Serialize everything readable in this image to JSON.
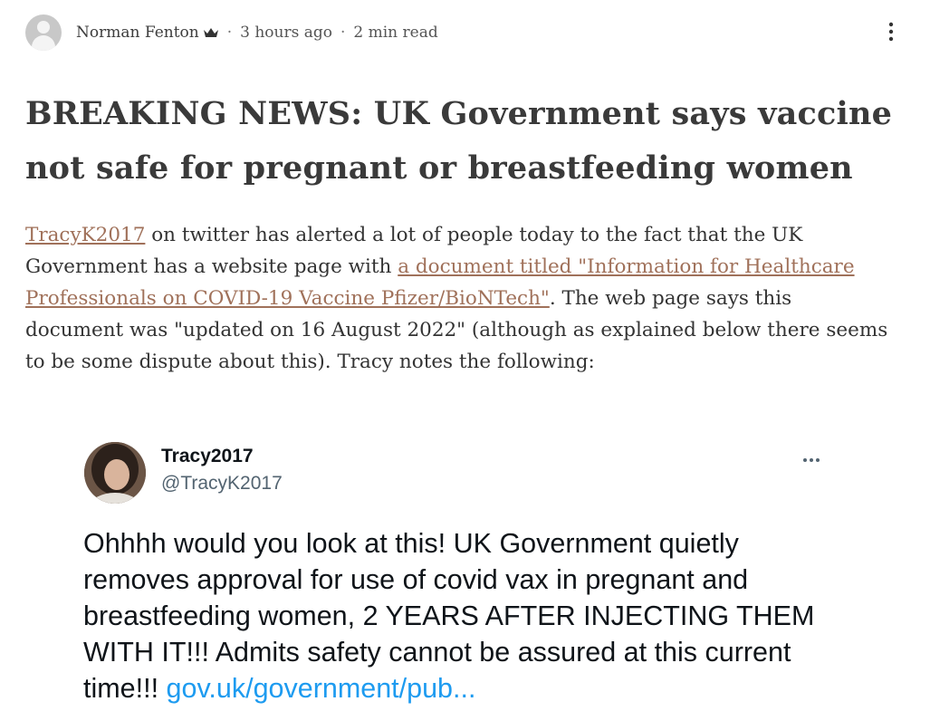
{
  "byline": {
    "author": "Norman Fenton",
    "crown_icon": "crown-icon",
    "separator": "·",
    "time": "3 hours ago",
    "read_time": "2 min read",
    "more_icon": "more-vertical-icon"
  },
  "article": {
    "title": "BREAKING NEWS: UK Government says vaccine not safe for pregnant or breastfeeding women",
    "para1": {
      "link1": "TracyK2017",
      "text1": " on twitter has alerted a lot of people today to the fact that the UK Government has a website page with ",
      "link2": "a document titled \"Information for Healthcare Professionals on COVID-19 Vaccine Pfizer/BioNTech\"",
      "text2": ". The web page says this document was \"updated on 16 August 2022\" (although as explained below there seems to be some dispute about this). Tracy notes the following:"
    }
  },
  "tweet": {
    "name": "Tracy2017",
    "handle": "@TracyK2017",
    "more_icon": "more-horizontal-icon",
    "text": "Ohhhh would you look at this! UK Government quietly removes approval for use of covid vax in pregnant and breastfeeding women, 2 YEARS AFTER INJECTING THEM WITH IT!!! Admits safety cannot be assured at this current time!!! ",
    "link": "gov.uk/government/pub..."
  },
  "colors": {
    "link": "#a0715a",
    "tweet_link": "#1d9bf0",
    "title": "#3a3a3a"
  }
}
